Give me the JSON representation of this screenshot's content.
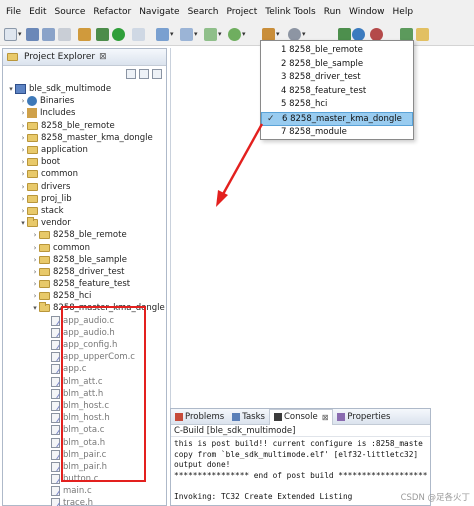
{
  "menubar": {
    "items": [
      "File",
      "Edit",
      "Source",
      "Refactor",
      "Navigate",
      "Search",
      "Project",
      "Telink Tools",
      "Run",
      "Window",
      "Help"
    ]
  },
  "explorer": {
    "title": "Project Explorer",
    "close_glyph": "⊠",
    "tree": [
      {
        "label": "ble_sdk_multimode",
        "icon": "project-icon",
        "arrow": "▾",
        "depth": 0
      },
      {
        "label": "Binaries",
        "icon": "binaries-icon",
        "arrow": "›",
        "depth": 1
      },
      {
        "label": "Includes",
        "icon": "includes-icon",
        "arrow": "›",
        "depth": 1
      },
      {
        "label": "8258_ble_remote",
        "icon": "folder-icon",
        "arrow": "›",
        "depth": 1
      },
      {
        "label": "8258_master_kma_dongle",
        "icon": "folder-icon",
        "arrow": "›",
        "depth": 1
      },
      {
        "label": "application",
        "icon": "folder-icon",
        "arrow": "›",
        "depth": 1
      },
      {
        "label": "boot",
        "icon": "folder-icon",
        "arrow": "›",
        "depth": 1
      },
      {
        "label": "common",
        "icon": "folder-icon",
        "arrow": "›",
        "depth": 1
      },
      {
        "label": "drivers",
        "icon": "folder-icon",
        "arrow": "›",
        "depth": 1
      },
      {
        "label": "proj_lib",
        "icon": "folder-icon",
        "arrow": "›",
        "depth": 1
      },
      {
        "label": "stack",
        "icon": "folder-icon",
        "arrow": "›",
        "depth": 1
      },
      {
        "label": "vendor",
        "icon": "folder-icon",
        "arrow": "▾",
        "depth": 1
      },
      {
        "label": "8258_ble_remote",
        "icon": "folder-icon",
        "arrow": "›",
        "depth": 2
      },
      {
        "label": "common",
        "icon": "folder-icon",
        "arrow": "›",
        "depth": 2
      },
      {
        "label": "8258_ble_sample",
        "icon": "folder-icon",
        "arrow": "›",
        "depth": 2
      },
      {
        "label": "8258_driver_test",
        "icon": "folder-icon",
        "arrow": "›",
        "depth": 2
      },
      {
        "label": "8258_feature_test",
        "icon": "folder-icon",
        "arrow": "›",
        "depth": 2
      },
      {
        "label": "8258_hci",
        "icon": "folder-icon",
        "arrow": "›",
        "depth": 2
      },
      {
        "label": "8258_master_kma_dongle",
        "icon": "folder-icon",
        "arrow": "▾",
        "depth": 2
      },
      {
        "label": "app_audio.c",
        "icon": "file-icon",
        "arrow": "",
        "depth": 3
      },
      {
        "label": "app_audio.h",
        "icon": "file-icon",
        "arrow": "",
        "depth": 3
      },
      {
        "label": "app_config.h",
        "icon": "file-icon",
        "arrow": "",
        "depth": 3
      },
      {
        "label": "app_upperCom.c",
        "icon": "file-icon",
        "arrow": "",
        "depth": 3
      },
      {
        "label": "app.c",
        "icon": "file-icon",
        "arrow": "",
        "depth": 3
      },
      {
        "label": "blm_att.c",
        "icon": "file-icon",
        "arrow": "",
        "depth": 3
      },
      {
        "label": "blm_att.h",
        "icon": "file-icon",
        "arrow": "",
        "depth": 3
      },
      {
        "label": "blm_host.c",
        "icon": "file-icon",
        "arrow": "",
        "depth": 3
      },
      {
        "label": "blm_host.h",
        "icon": "file-icon",
        "arrow": "",
        "depth": 3
      },
      {
        "label": "blm_ota.c",
        "icon": "file-icon",
        "arrow": "",
        "depth": 3
      },
      {
        "label": "blm_ota.h",
        "icon": "file-icon",
        "arrow": "",
        "depth": 3
      },
      {
        "label": "blm_pair.c",
        "icon": "file-icon",
        "arrow": "",
        "depth": 3
      },
      {
        "label": "blm_pair.h",
        "icon": "file-icon",
        "arrow": "",
        "depth": 3
      },
      {
        "label": "button.c",
        "icon": "file-icon",
        "arrow": "",
        "depth": 3
      },
      {
        "label": "main.c",
        "icon": "file-icon",
        "arrow": "",
        "depth": 3
      },
      {
        "label": "trace.h",
        "icon": "file-icon",
        "arrow": "",
        "depth": 3
      }
    ]
  },
  "build_dropdown": {
    "items": [
      {
        "label": "1 8258_ble_remote",
        "selected": false
      },
      {
        "label": "2 8258_ble_sample",
        "selected": false
      },
      {
        "label": "3 8258_driver_test",
        "selected": false
      },
      {
        "label": "4 8258_feature_test",
        "selected": false
      },
      {
        "label": "5 8258_hci",
        "selected": false
      },
      {
        "label": "6 8258_master_kma_dongle",
        "selected": true
      },
      {
        "label": "7 8258_module",
        "selected": false
      }
    ],
    "check_glyph": "✓"
  },
  "console": {
    "tabs": [
      {
        "label": "Problems",
        "active": false
      },
      {
        "label": "Tasks",
        "active": false
      },
      {
        "label": "Console",
        "active": true
      },
      {
        "label": "Properties",
        "active": false
      }
    ],
    "close_glyph": "⊠",
    "subtitle": "C-Build [ble_sdk_multimode]",
    "lines": [
      "this is post build!! current configure is :8258_maste",
      "copy from `ble_sdk_multimode.elf' [elf32-littletc32]",
      "output done!",
      "**************** end of post build *******************",
      "",
      "Invoking: TC32 Create Extended Listing"
    ]
  },
  "watermark": "CSDN @足各火丁",
  "colors": {
    "annotation_red": "#e3201e",
    "selection_blue": "#99ccf0"
  }
}
